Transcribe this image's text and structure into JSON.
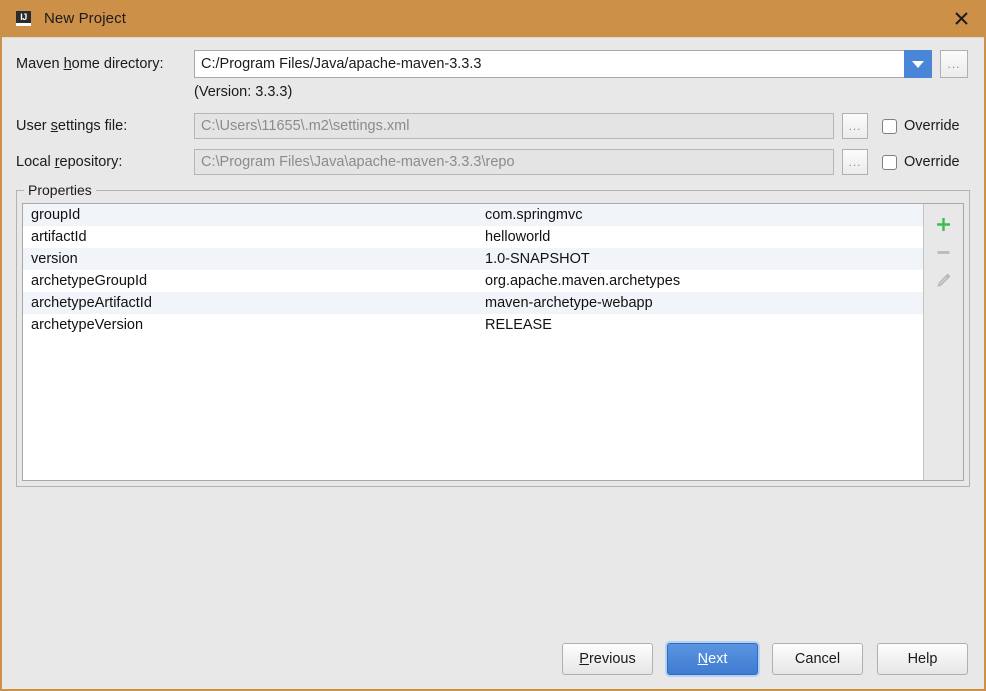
{
  "window": {
    "title": "New Project",
    "app_icon": "intellij-idea-icon",
    "close_icon": "close-icon",
    "titlebar_color": "#cc9049",
    "accent_color": "#4a86d8"
  },
  "form": {
    "maven_home": {
      "label_pre": "Maven ",
      "label_mnemonic": "h",
      "label_post": "ome directory:",
      "value": "C:/Program Files/Java/apache-maven-3.3.3",
      "dropdown_icon": "chevron-down-icon",
      "browse_label": "...",
      "version_note": "(Version: 3.3.3)"
    },
    "user_settings": {
      "label_pre": "User ",
      "label_mnemonic": "s",
      "label_post": "ettings file:",
      "value": "C:\\Users\\11655\\.m2\\settings.xml",
      "browse_label": "...",
      "override_label": "Override",
      "override_checked": false
    },
    "local_repository": {
      "label_pre": "Local ",
      "label_mnemonic": "r",
      "label_post": "epository:",
      "value": "C:\\Program Files\\Java\\apache-maven-3.3.3\\repo",
      "browse_label": "...",
      "override_label": "Override",
      "override_checked": false
    }
  },
  "properties": {
    "title": "Properties",
    "rows": [
      {
        "key": "groupId",
        "value": "com.springmvc"
      },
      {
        "key": "artifactId",
        "value": "helloworld"
      },
      {
        "key": "version",
        "value": "1.0-SNAPSHOT"
      },
      {
        "key": "archetypeGroupId",
        "value": "org.apache.maven.archetypes"
      },
      {
        "key": "archetypeArtifactId",
        "value": "maven-archetype-webapp"
      },
      {
        "key": "archetypeVersion",
        "value": "RELEASE"
      }
    ],
    "toolbar": {
      "add_icon": "plus-icon",
      "remove_icon": "minus-icon",
      "edit_icon": "pencil-icon",
      "add_color": "#3fba54",
      "disabled_color": "#b6b6b6"
    }
  },
  "footer": {
    "previous": {
      "pre": "",
      "mnemonic": "P",
      "post": "revious"
    },
    "next": {
      "pre": "",
      "mnemonic": "N",
      "post": "ext"
    },
    "cancel": "Cancel",
    "help": "Help"
  }
}
